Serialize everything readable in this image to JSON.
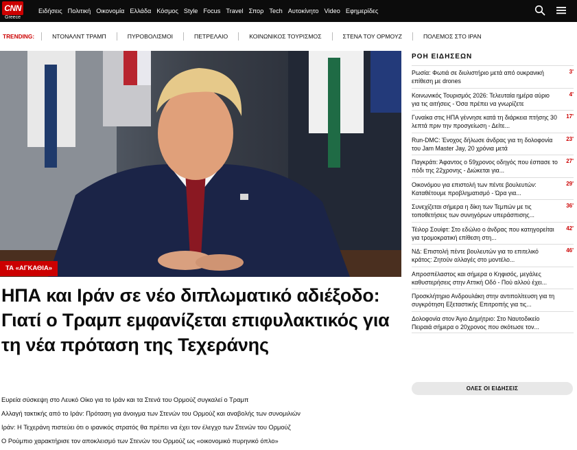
{
  "brand": {
    "logo_text": "CNN",
    "logo_sub": "Greece",
    "accent": "#cc0000"
  },
  "nav": {
    "items": [
      "Ειδήσεις",
      "Πολιτική",
      "Οικονομία",
      "Ελλάδα",
      "Κόσμος",
      "Style",
      "Focus",
      "Travel",
      "Σπορ",
      "Tech",
      "Αυτοκίνητο",
      "Video",
      "Εφημερίδες"
    ],
    "search_icon": "search-icon",
    "menu_icon": "hamburger-menu-icon"
  },
  "trending": {
    "label": "TRENDING:",
    "items": [
      "ΝΤΟΝΑΛΝΤ ΤΡΑΜΠ",
      "ΠΥΡΟΒΟΛΙΣΜΟΙ",
      "ΠΕΤΡΕΛΑΙΟ",
      "ΚΟΙΝΩΝΙΚΟΣ ΤΟΥΡΙΣΜΟΣ",
      "ΣΤΕΝΑ ΤΟΥ ΟΡΜΟΥΖ",
      "ΠΟΛΕΜΟΣ ΣΤΟ ΙΡΑΝ"
    ]
  },
  "hero": {
    "badge": "ΤΑ «ΑΓΚΑΘΙΑ»",
    "headline": "ΗΠΑ και Ιράν σε νέο διπλωματικό αδιέξοδο: Γιατί ο Τραμπ εμφανίζεται επιφυλακτικός για τη νέα πρόταση της Τεχεράνης",
    "related": [
      "Ευρεία σύσκεψη στο Λευκό Οίκο για το Ιράν και τα Στενά του Ορμούζ συγκαλεί ο Τραμπ",
      "Αλλαγή τακτικής από το Ιράν: Πρόταση για άνοιγμα των Στενών του Ορμούζ και αναβολής των συνομιλιών",
      "Ιράν: Η Τεχεράνη πιστεύει ότι ο ιρανικός στρατός θα πρέπει να έχει τον έλεγχο των Στενών του Ορμούζ",
      "Ο Ρούμπιο χαρακτήρισε τον αποκλεισμό των Στενών του Ορμούζ ως «οικονομικό πυρηνικό όπλο»"
    ]
  },
  "feed": {
    "title": "ΡΟΗ ΕΙΔΗΣΕΩΝ",
    "items": [
      {
        "text": "Ρωσία: Φωτιά σε διυλιστήριο μετά από ουκρανική επίθεση με drones",
        "time": "3'"
      },
      {
        "text": "Κοινωνικός Τουρισμός 2026: Τελευταία ημέρα αύριο για τις αιτήσεις - Όσα πρέπει να γνωρίζετε",
        "time": "4'"
      },
      {
        "text": "Γυναίκα στις ΗΠΑ γέννησε κατά τη διάρκεια πτήσης 30 λεπτά πριν την προσγείωση - Δείτε...",
        "time": "17'"
      },
      {
        "text": "Run-DMC: Ένοχος δήλωσε άνδρας για τη δολοφονία του Jam Master Jay, 20 χρόνια μετά",
        "time": "23'"
      },
      {
        "text": "Παγκράτι: Άφαντος ο 59χρονος οδηγός που έσπασε το πόδι της 22χρονης - Διώκεται για...",
        "time": "27'"
      },
      {
        "text": "Οικονόμου για επιστολή των πέντε βουλευτών: Καταθέτουμε προβληματισμό - Ώρα για...",
        "time": "29'"
      },
      {
        "text": "Συνεχίζεται σήμερα η δίκη των Τεμπών με τις τοποθετήσεις των συνηγόρων υπεράσπισης...",
        "time": "36'"
      },
      {
        "text": "Τέιλορ Σουίφτ: Στο εδώλιο ο άνδρας που κατηγορείται για τρομοκρατική επίθεση στη...",
        "time": "42'"
      },
      {
        "text": "ΝΔ: Επιστολή πέντε βουλευτών για το επιτελικό κράτος: Ζητούν αλλαγές στο μοντέλο...",
        "time": "46'"
      },
      {
        "text": "Απροσπέλαστος και σήμερα ο Κηφισός, μεγάλες καθυστερήσεις στην Αττική Οδό - Πού αλλού έχει...",
        "time": ""
      },
      {
        "text": "Προσκλήτηριο Ανδρουλάκη στην αντιπολίτευση για τη συγκρότηση Εξεταστικής Επιτροπής για τις...",
        "time": ""
      },
      {
        "text": "Δολοφονία στον Άγιο Δημήτριο: Στο Ναυτοδικείο Πειραιά σήμερα ο 20χρονος που σκότωσε τον...",
        "time": ""
      }
    ],
    "more_button": "ΟΛΕΣ ΟΙ ΕΙΔΗΣΕΙΣ"
  }
}
